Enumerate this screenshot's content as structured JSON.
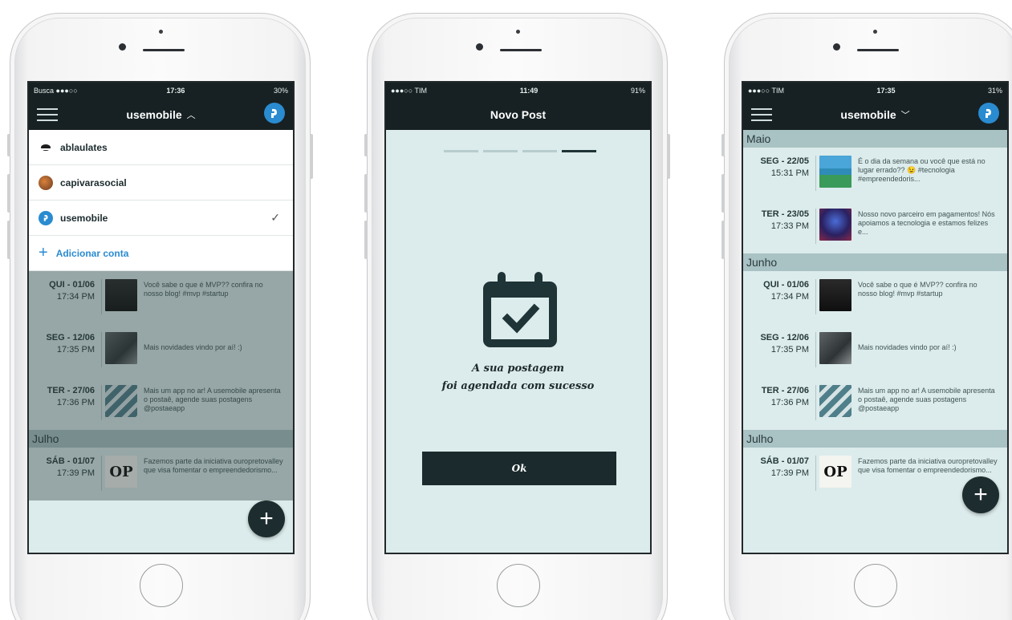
{
  "phone1": {
    "status": {
      "left": "Busca ●●●○○",
      "time": "17:36",
      "right": "30%"
    },
    "nav_title": "usemobile",
    "accounts": [
      {
        "name": "ablaulates"
      },
      {
        "name": "capivarasocial"
      },
      {
        "name": "usemobile",
        "selected": true
      }
    ],
    "add_account": "Adicionar conta",
    "months": [
      "Julho"
    ],
    "posts": [
      {
        "day": "QUI - 01/06",
        "time": "17:34 PM",
        "text": "Você sabe o que é MVP?? confira no nosso blog! #mvp #startup"
      },
      {
        "day": "SEG - 12/06",
        "time": "17:35 PM",
        "text": "Mais novidades vindo por aí! :)"
      },
      {
        "day": "TER - 27/06",
        "time": "17:36 PM",
        "text": "Mais um app no ar! A usemobile apresenta o postaê, agende suas postagens @postaeapp"
      },
      {
        "day": "SÁB - 01/07",
        "time": "17:39 PM",
        "text": "Fazemos parte da iniciativa ouropretovalley que visa fomentar o empreendedorismo..."
      }
    ],
    "fab": "+"
  },
  "phone2": {
    "status": {
      "left": "●●●○○ TIM",
      "time": "11:49",
      "right": "91%"
    },
    "nav_title": "Novo Post",
    "steps_total": 4,
    "steps_active": 4,
    "message_line1": "A sua postagem",
    "message_line2": "foi agendada com sucesso",
    "ok_label": "Ok"
  },
  "phone3": {
    "status": {
      "left": "●●●○○ TIM",
      "time": "17:35",
      "right": "31%"
    },
    "nav_title": "usemobile",
    "months": [
      "Maio",
      "Junho",
      "Julho"
    ],
    "posts_maio": [
      {
        "day": "SEG - 22/05",
        "time": "15:31 PM",
        "text": "É o dia da semana ou você que está no lugar errado?? 😉 #tecnologia #empreendedoris..."
      },
      {
        "day": "TER - 23/05",
        "time": "17:33 PM",
        "text": "Nosso novo parceiro em pagamentos! Nós apoiamos a tecnologia e estamos felizes e..."
      }
    ],
    "posts_junho": [
      {
        "day": "QUI - 01/06",
        "time": "17:34 PM",
        "text": "Você sabe o que é MVP?? confira no nosso blog! #mvp #startup"
      },
      {
        "day": "SEG - 12/06",
        "time": "17:35 PM",
        "text": "Mais novidades vindo por aí! :)"
      },
      {
        "day": "TER - 27/06",
        "time": "17:36 PM",
        "text": "Mais um app no ar! A usemobile apresenta o postaê, agende suas postagens @postaeapp"
      }
    ],
    "posts_julho": [
      {
        "day": "SÁB - 01/07",
        "time": "17:39 PM",
        "text": "Fazemos parte da iniciativa ouropretovalley que visa fomentar o empreendedorismo..."
      }
    ],
    "fab": "+"
  },
  "colors": {
    "nav": "#172123",
    "screen_bg": "#dcebeb",
    "month_bar": "#a9c2c4",
    "accent": "#2a8bd0",
    "button": "#1b2b2d"
  },
  "icons": [
    "hamburger-icon",
    "usemobile-logo-icon",
    "chevron-up-icon",
    "chevron-down-icon",
    "checkmark-icon",
    "plus-icon",
    "calendar-check-icon"
  ]
}
